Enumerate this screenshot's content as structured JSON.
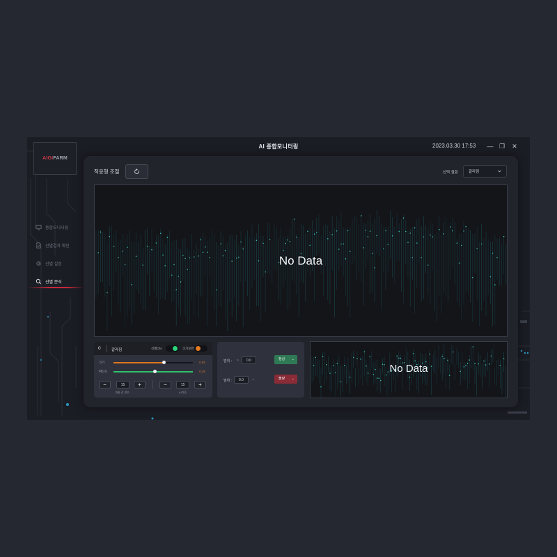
{
  "app": {
    "title": "AI 종합모니터링",
    "datetime": "2023.03.30  17:53"
  },
  "window_controls": {
    "minimize": "—",
    "restore": "❐",
    "close": "✕"
  },
  "brand": {
    "logo_prefix": "AIGI",
    "logo_suffix": "FARM"
  },
  "sidebar": {
    "items": [
      {
        "label": "종합모니터링",
        "icon": "monitor-icon",
        "active": false
      },
      {
        "label": "선별결과 확인",
        "icon": "document-check-icon",
        "active": false
      },
      {
        "label": "선별 설정",
        "icon": "gear-icon",
        "active": false
      },
      {
        "label": "선별 분석",
        "icon": "search-icon",
        "active": true
      }
    ]
  },
  "main": {
    "title": "적응형 조절",
    "refresh_icon": "refresh-icon",
    "select_label": "선택 결함",
    "select_value": "갈라짐",
    "chart_empty": "No Data"
  },
  "control_panel": {
    "index": "0",
    "name": "갈라짐",
    "toggle1": {
      "label": "선별ON",
      "on": true,
      "color": "#2ad37a"
    },
    "toggle2": {
      "label": "크기보완",
      "on": true,
      "color": "#e57b1f"
    },
    "sliders": [
      {
        "label": "크기",
        "value": "0.55",
        "fraction": 0.63,
        "color": "#e0761e"
      },
      {
        "label": "확신도",
        "value": "0.45",
        "fraction": 0.52,
        "color": "#2ec46b"
      }
    ],
    "steppers": [
      {
        "minus": "−",
        "value": "15",
        "plus": "+",
        "label": "과밀 강 경수"
      },
      {
        "minus": "−",
        "value": "15",
        "plus": "+",
        "label": "AI기준"
      }
    ]
  },
  "range_panel": {
    "row1": {
      "label": "범위 :",
      "tilde": "~",
      "value": "0.0",
      "badge": "정상",
      "badge_color": "#2f7a55"
    },
    "row2": {
      "label": "범위 :",
      "value": "0.0",
      "tilde": "~",
      "badge": "불량",
      "badge_color": "#8a2b36"
    }
  },
  "small_chart": {
    "empty": "No Data"
  }
}
